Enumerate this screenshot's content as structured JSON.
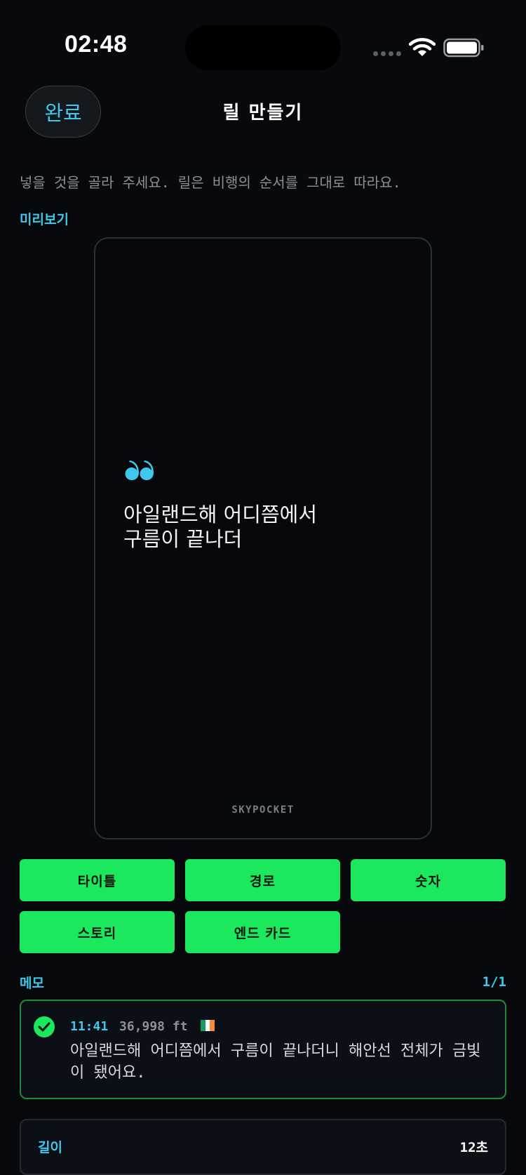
{
  "status_bar": {
    "time": "02:48"
  },
  "header": {
    "done_label": "완료",
    "title": "릴 만들기"
  },
  "instruction": "넣을 것을 골라 주세요. 릴은 비행의 순서를 그대로 따라요.",
  "preview": {
    "label": "미리보기",
    "quote_icon": "quote-open-icon",
    "quote_line1": "아일랜드해 어디쯤에서",
    "quote_line2": "구름이 끝나더",
    "brand": "SKYPOCKET"
  },
  "sections": [
    "타이틀",
    "경로",
    "숫자",
    "스토리",
    "엔드 카드"
  ],
  "memo": {
    "label": "메모",
    "count": "1/1",
    "item": {
      "time": "11:41",
      "altitude": "36,998 ft",
      "text": "아일랜드해 어디쯤에서 구름이 끝나더니 해안선 전체가 금빛이 됐어요."
    }
  },
  "length": {
    "label": "길이",
    "value": "12초"
  },
  "colors": {
    "accent": "#3fc8ec",
    "green": "#1be85d",
    "background": "#07090d"
  }
}
